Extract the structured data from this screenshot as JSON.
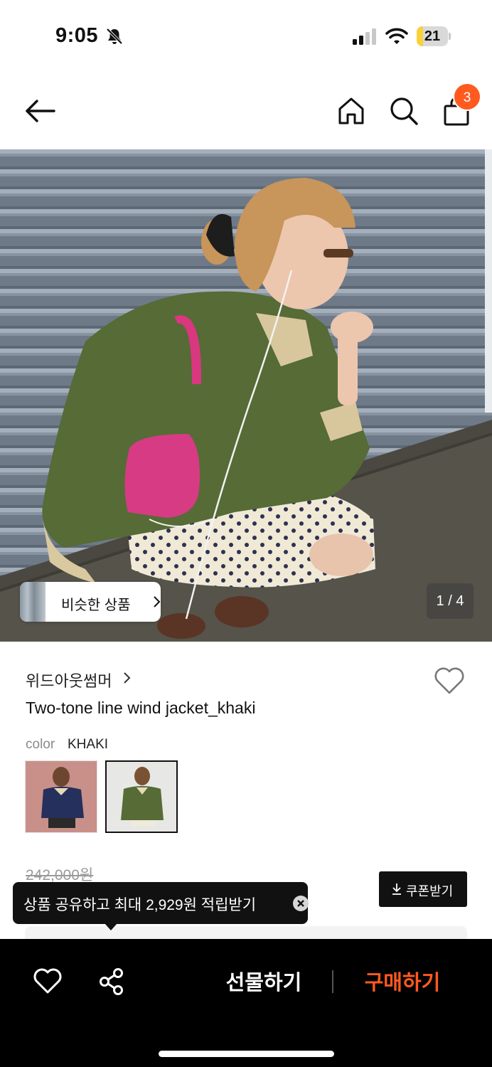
{
  "status_bar": {
    "time": "9:05",
    "battery_level": "21",
    "battery_fraction": 0.21,
    "battery_color": "#f7d23c"
  },
  "header": {
    "bag_count": "3",
    "accent_color": "#ff5a1f",
    "icons": [
      "arrow-left-icon",
      "home-icon",
      "search-icon",
      "shopping-bag-icon"
    ]
  },
  "gallery": {
    "similar_label": "비슷한 상품",
    "counter": "1 / 4"
  },
  "product": {
    "brand": "위드아웃썸머",
    "name": "Two-tone line wind jacket_khaki",
    "color_label": "color",
    "color_value": "KHAKI",
    "original_price": "242,000원"
  },
  "coupon": {
    "label": "쿠폰받기"
  },
  "tooltip": {
    "text": "상품 공유하고 최대 2,929원 적립받기"
  },
  "bottom_bar": {
    "gift_label": "선물하기",
    "buy_label": "구매하기",
    "buy_color": "#ff5a1f"
  }
}
